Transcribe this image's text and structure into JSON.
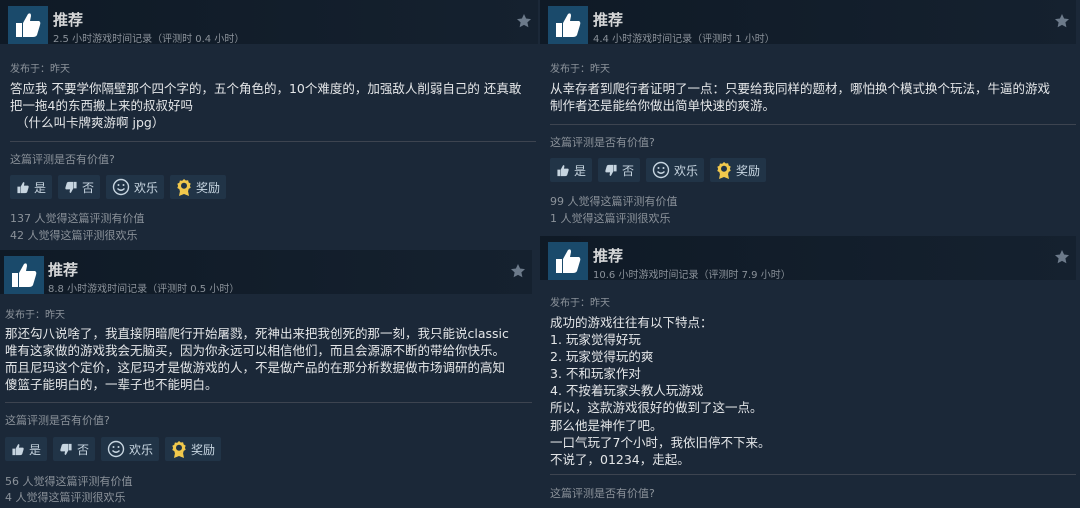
{
  "ui": {
    "posted_label": "发布于：昨天",
    "helpful_question": "这篇评测是否有价值?",
    "btn_yes": "是",
    "btn_no": "否",
    "btn_funny": "欢乐",
    "btn_award": "奖励"
  },
  "reviews": [
    {
      "title": "推荐",
      "hours": "2.5 小时游戏时间记录（评测时 0.4 小时）",
      "lines": [
        "答应我 不要学你隔壁那个四个字的，五个角色的，10个难度的，加强敌人削弱自己的 还真敢",
        "把一拖4的东西搬上来的叔叔好吗",
        "（什么叫卡牌爽游啊 jpg）"
      ],
      "helpful_count": "137 人觉得这篇评测有价值",
      "funny_count": "42 人觉得这篇评测很欢乐"
    },
    {
      "title": "推荐",
      "hours": "4.4 小时游戏时间记录（评测时 1 小时）",
      "lines": [
        "从幸存者到爬行者证明了一点：只要给我同样的题材，哪怕换个模式换个玩法，牛逼的游戏",
        "制作者还是能给你做出简单快速的爽游。"
      ],
      "helpful_count": "99 人觉得这篇评测有价值",
      "funny_count": "1 人觉得这篇评测很欢乐"
    },
    {
      "title": "推荐",
      "hours": "8.8 小时游戏时间记录（评测时 0.5 小时）",
      "lines": [
        "那还勾八说啥了，我直接阴暗爬行开始屠戮，死神出来把我创死的那一刻，我只能说classic",
        "唯有这家做的游戏我会无脑买，因为你永远可以相信他们，而且会源源不断的带给你快乐。",
        "而且尼玛这个定价，这尼玛才是做游戏的人，不是做产品的在那分析数据做市场调研的高知",
        "傻篮子能明白的，一辈子也不能明白。"
      ],
      "helpful_count": "56 人觉得这篇评测有价值",
      "funny_count": "4 人觉得这篇评测很欢乐"
    },
    {
      "title": "推荐",
      "hours": "10.6 小时游戏时间记录（评测时 7.9 小时）",
      "lines": [
        "成功的游戏往往有以下特点：",
        "1. 玩家觉得好玩",
        "2. 玩家觉得玩的爽",
        "3. 不和玩家作对",
        "4. 不按着玩家头教人玩游戏",
        "所以，这款游戏很好的做到了这一点。",
        "那么他是神作了吧。",
        "一口气玩了7个小时，我依旧停不下来。",
        "不说了，01234，走起。"
      ]
    }
  ]
}
